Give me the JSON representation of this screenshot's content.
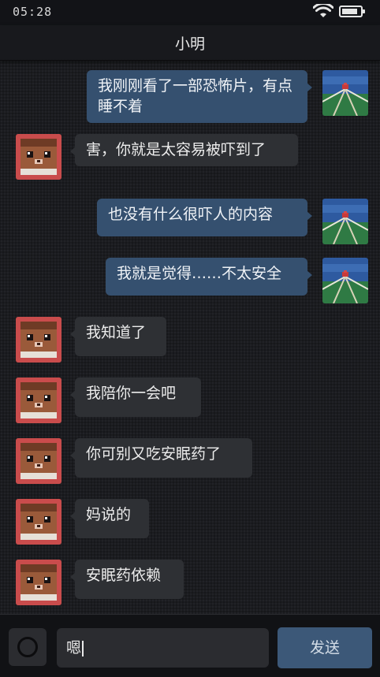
{
  "status_bar": {
    "time": "05:28",
    "wifi_icon": "wifi-icon",
    "battery_icon": "battery-icon",
    "battery_level": 0.85
  },
  "header": {
    "title": "小明"
  },
  "messages": [
    {
      "side": "sent",
      "text": "我刚刚看了一部恐怖片，有点睡不着",
      "avatar": "landscape-avatar"
    },
    {
      "side": "recv",
      "text": "害，你就是太容易被吓到了",
      "avatar": "cat-avatar"
    },
    {
      "side": "sent",
      "text": "也没有什么很吓人的内容",
      "avatar": "landscape-avatar"
    },
    {
      "side": "sent",
      "text": "我就是觉得……不太安全",
      "avatar": "landscape-avatar"
    },
    {
      "side": "recv",
      "text": "我知道了",
      "avatar": "cat-avatar"
    },
    {
      "side": "recv",
      "text": "我陪你一会吧",
      "avatar": "cat-avatar"
    },
    {
      "side": "recv",
      "text": "你可别又吃安眠药了",
      "avatar": "cat-avatar"
    },
    {
      "side": "recv",
      "text": "妈说的",
      "avatar": "cat-avatar"
    },
    {
      "side": "recv",
      "text": "安眠药依赖",
      "avatar": "cat-avatar"
    }
  ],
  "input_bar": {
    "camera_icon": "camera-icon",
    "input_value": "嗯",
    "send_label": "发送"
  },
  "colors": {
    "sent_bubble": "#35506f",
    "recv_bubble": "#2e3034",
    "send_button": "#3c5878"
  }
}
